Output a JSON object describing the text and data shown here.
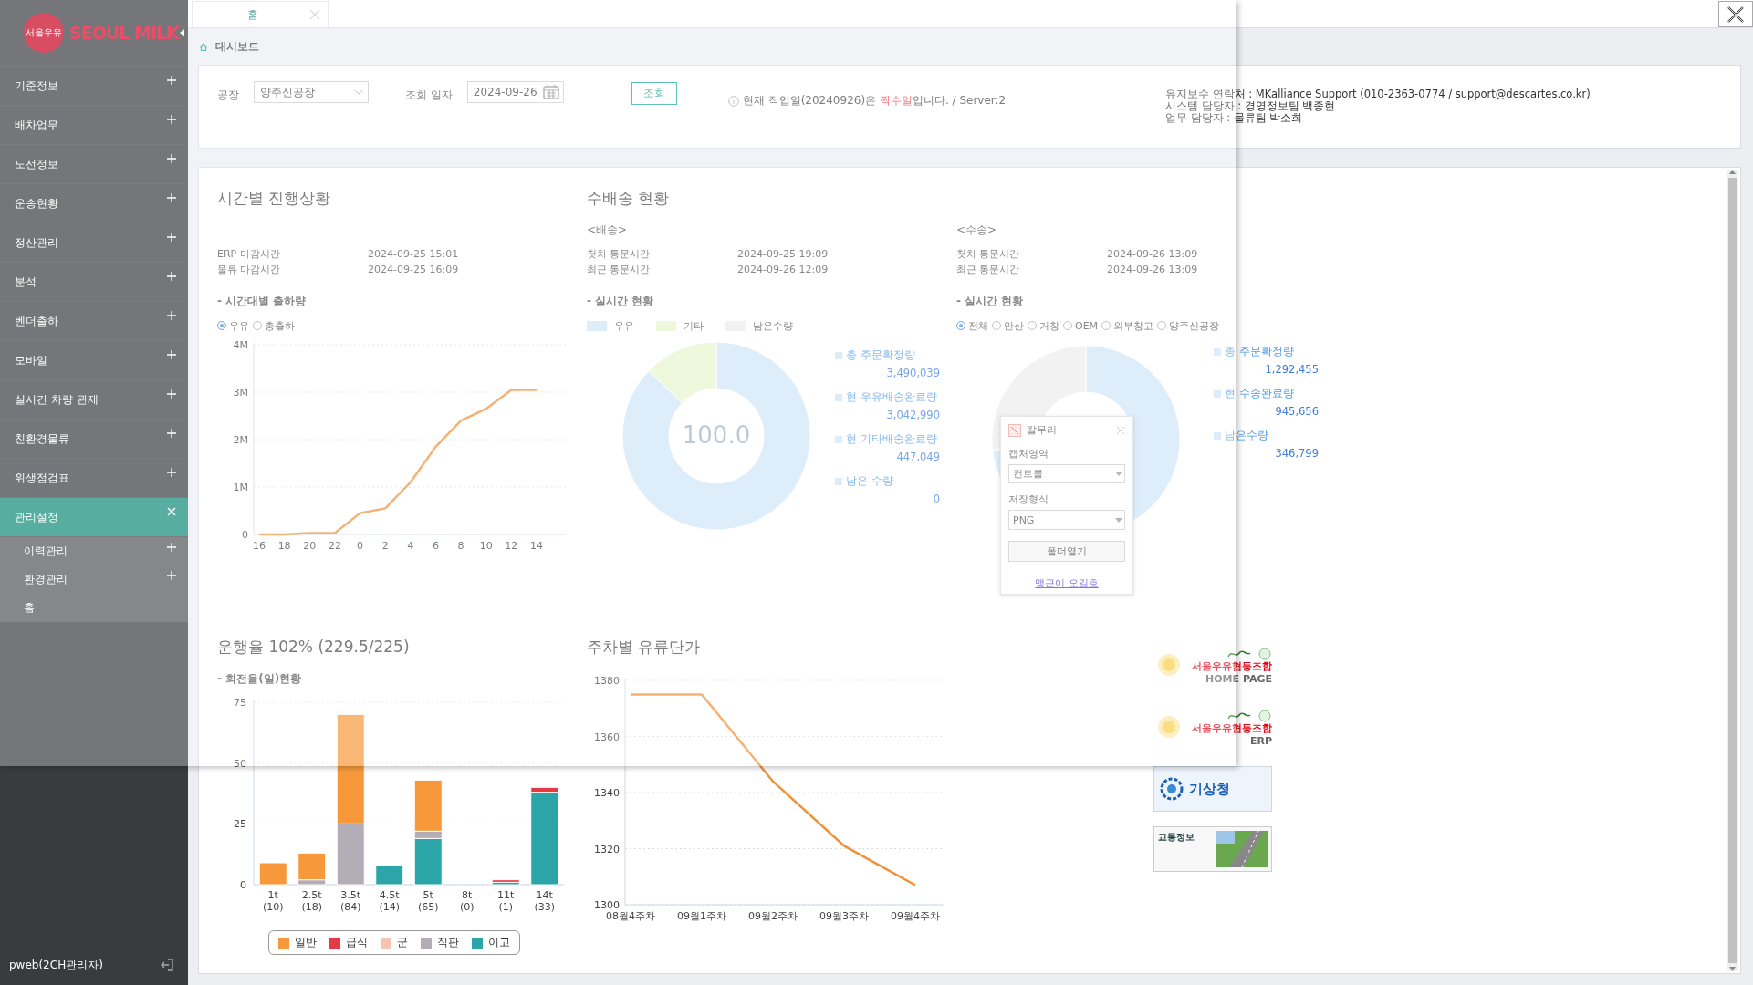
{
  "top_tabs": [
    {
      "label": "홈",
      "selected": true
    }
  ],
  "sidebar": {
    "logo": {
      "badge": "서울우유",
      "name": "SEOUL MILK"
    },
    "items": [
      {
        "label": "기준정보",
        "kind": "group",
        "expanded": false
      },
      {
        "label": "배차업무",
        "kind": "group",
        "expanded": false
      },
      {
        "label": "노선정보",
        "kind": "group",
        "expanded": false
      },
      {
        "label": "운송현황",
        "kind": "group",
        "expanded": false
      },
      {
        "label": "정산관리",
        "kind": "group",
        "expanded": false
      },
      {
        "label": "분석",
        "kind": "group",
        "expanded": false
      },
      {
        "label": "벤더출하",
        "kind": "group",
        "expanded": false
      },
      {
        "label": "모바일",
        "kind": "group",
        "expanded": false
      },
      {
        "label": "실시간 차량 관제",
        "kind": "group",
        "expanded": false
      },
      {
        "label": "친환경물류",
        "kind": "group",
        "expanded": false
      },
      {
        "label": "위생점검표",
        "kind": "group",
        "expanded": false
      },
      {
        "label": "관리설정",
        "kind": "group",
        "expanded": true,
        "children": [
          {
            "label": "이력관리",
            "kind": "group",
            "expanded": false
          },
          {
            "label": "환경관리",
            "kind": "group",
            "expanded": false
          },
          {
            "label": "홈",
            "kind": "page"
          }
        ]
      }
    ],
    "user": "pweb(2CH관리자)"
  },
  "breadcrumb": "대시보드",
  "filter": {
    "plant_label": "공장",
    "plant": "양주신공장",
    "date_label": "조회 일자",
    "date": "2024-09-26",
    "search_button": "조회",
    "notice": "현재 작업일(20240926)은 **짝수일**입니다. / Server:2"
  },
  "contact": [
    "유지보수 연락처 : MKalliance Support (010-2363-0774 / support@descartes.co.kr)",
    "시스템 담당자 : 경영정보팀 백종현",
    "업무 담당자 : 물류팀 박소희"
  ],
  "progress": {
    "title": "시간별 진행상황",
    "rows": [
      {
        "label": "ERP 마감시간",
        "value": "2024-09-25 15:01"
      },
      {
        "label": "물류 마감시간",
        "value": "2024-09-25 16:09"
      }
    ],
    "subtitle": "- 시간대별 출하량",
    "options": [
      {
        "label": "우유",
        "selected": true
      },
      {
        "label": "총출하",
        "selected": false
      }
    ],
    "chart_data": {
      "type": "line",
      "categories": [
        "16",
        "18",
        "20",
        "22",
        "0",
        "2",
        "4",
        "6",
        "8",
        "10",
        "12",
        "14"
      ],
      "grid": true,
      "series": [
        {
          "color": "#f0913a",
          "values": [
            0,
            0,
            30000,
            30000,
            450000,
            550000,
            1100000,
            1850000,
            2400000,
            2650000,
            3050000,
            3050000
          ]
        }
      ],
      "ylim": [
        0,
        4000000
      ],
      "yticks": [
        {
          "value": 0,
          "label": "0"
        },
        {
          "value": 1000000,
          "label": "1M"
        },
        {
          "value": 2000000,
          "label": "2M"
        },
        {
          "value": 3000000,
          "label": "3M"
        },
        {
          "value": 4000000,
          "label": "4M"
        }
      ]
    }
  },
  "delivery": {
    "title": "수배송 현황",
    "heading": "<배송>",
    "rows": [
      {
        "label": "첫차 통문시간",
        "value": "2024-09-25 19:09"
      },
      {
        "label": "최근 통문시간",
        "value": "2024-09-26 12:09"
      }
    ],
    "subtitle": "- 실시간 현황",
    "chart_data": {
      "type": "donut",
      "categories": [
        "우유",
        "기타",
        "남은수량"
      ],
      "colors": [
        "#cfe5f8",
        "#e6f5cf",
        "#ececec"
      ],
      "series": [
        {
          "values": [
            87.2,
            12.8,
            0
          ]
        }
      ]
    },
    "center": "100.0",
    "totals": [
      {
        "label": "총 주문확정량",
        "value": "3,490,039"
      },
      {
        "label": "현 우유배송완료량",
        "value": "3,042,990"
      },
      {
        "label": "현 기타배송완료량",
        "value": "447,049"
      },
      {
        "label": "남은 수량",
        "value": "0"
      }
    ]
  },
  "transport": {
    "heading": "<수송>",
    "rows": [
      {
        "label": "첫차 통문시간",
        "value": "2024-09-26 13:09"
      },
      {
        "label": "최근 통문시간",
        "value": "2024-09-26 13:09"
      }
    ],
    "subtitle": "- 실시간 현황",
    "options": [
      {
        "label": "전체",
        "selected": true
      },
      {
        "label": "안산",
        "selected": false
      },
      {
        "label": "거창",
        "selected": false
      },
      {
        "label": "OEM",
        "selected": false
      },
      {
        "label": "외부창고",
        "selected": false
      },
      {
        "label": "양주신공장",
        "selected": false
      }
    ],
    "chart_data": {
      "type": "donut",
      "colors": [
        "#cfe5f8",
        "#ececec"
      ],
      "series": [
        {
          "values": [
            73.2,
            26.8
          ]
        }
      ]
    },
    "totals": [
      {
        "label": "총 주문확정량",
        "value": "1,292,455"
      },
      {
        "label": "현 수송완료량",
        "value": "945,656"
      },
      {
        "label": "남은수량",
        "value": "346,799"
      }
    ]
  },
  "capture_dialog": {
    "title": "칼무리",
    "area_label": "캡처영역",
    "area": "컨트롤",
    "format_label": "저장형식",
    "format": "PNG",
    "folder_button": "폴더열기",
    "credit_link": "맹근이 오길호"
  },
  "rotation": {
    "title": "운행율 102% (229.5/225)",
    "subtitle": "- 회전율(일)현황",
    "chart_data": {
      "type": "bar",
      "stacked": true,
      "grid": true,
      "categories": [
        "1t\n(10)",
        "2.5t\n(18)",
        "3.5t\n(84)",
        "4.5t\n(14)",
        "5t\n(65)",
        "8t\n(0)",
        "11t\n(1)",
        "14t\n(33)"
      ],
      "series": [
        {
          "name": "일반",
          "color": "#f7993a",
          "values": [
            9,
            11,
            45,
            0,
            21,
            0,
            0,
            0
          ]
        },
        {
          "name": "급식",
          "color": "#e63946",
          "values": [
            0,
            0,
            0,
            0,
            0,
            0,
            1,
            2
          ]
        },
        {
          "name": "군",
          "color": "#f6c5b0",
          "values": [
            0,
            0,
            0,
            0,
            0,
            0,
            0,
            0
          ]
        },
        {
          "name": "직판",
          "color": "#b3adb5",
          "values": [
            0,
            2,
            25,
            0,
            3,
            0,
            0,
            0
          ]
        },
        {
          "name": "이고",
          "color": "#2ca5a8",
          "values": [
            0,
            0,
            0,
            8,
            19,
            0,
            1,
            38
          ]
        }
      ],
      "ylim": [
        0,
        75
      ],
      "yticks": [
        {
          "value": 0,
          "label": "0"
        },
        {
          "value": 25,
          "label": "25"
        },
        {
          "value": 50,
          "label": "50"
        },
        {
          "value": 75,
          "label": "75"
        }
      ]
    }
  },
  "fuel": {
    "title": "주차별 유류단가",
    "chart_data": {
      "type": "line",
      "categories": [
        "08월4주차",
        "09월1주차",
        "09월2주차",
        "09월3주차",
        "09월4주차"
      ],
      "grid": true,
      "series": [
        {
          "color": "#f0913a",
          "values": [
            1375,
            1375,
            1344,
            1321,
            1307
          ]
        }
      ],
      "ylim": [
        1300,
        1380
      ],
      "yticks": [
        {
          "value": 1300,
          "label": "1300"
        },
        {
          "value": 1320,
          "label": "1320"
        },
        {
          "value": 1340,
          "label": "1340"
        },
        {
          "value": 1360,
          "label": "1360"
        },
        {
          "value": 1380,
          "label": "1380"
        }
      ]
    }
  },
  "links": [
    {
      "kind": "milk",
      "org": "서울우유협동조합",
      "label": "HOME PAGE"
    },
    {
      "kind": "milk",
      "org": "서울우유협동조합",
      "label": "ERP"
    },
    {
      "kind": "weather",
      "label": "기상청"
    },
    {
      "kind": "traffic",
      "label": "교통정보"
    }
  ]
}
